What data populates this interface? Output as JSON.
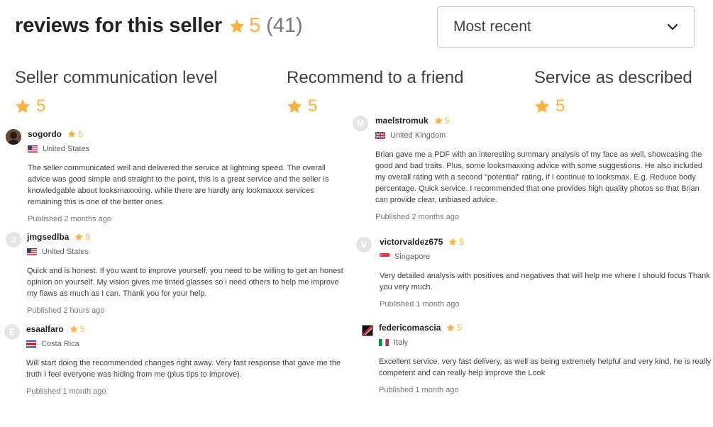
{
  "header": {
    "title": "reviews for this seller",
    "rating": "5",
    "count": "(41)",
    "star_color": "#ffb33e"
  },
  "sort": {
    "selected": "Most recent",
    "icon": "chevron-down-icon"
  },
  "categories": [
    {
      "label": "Seller communication level",
      "rating": "5"
    },
    {
      "label": "Recommend to a friend",
      "rating": "5"
    },
    {
      "label": "Service as described",
      "rating": "5"
    }
  ],
  "reviews": [
    {
      "username": "sogordo",
      "rating": "5",
      "country": "United States",
      "flag": "us-flag-icon",
      "avatar": "user-photo",
      "text": "The seller communicated well and delivered the service at lightning speed. The overall advice was good simple and straight to the point, this is a great service and the seller is knowledgable about looksmaxxxing. while there are hardly any lookmaxxx services remaining this is one of the better ones.",
      "published": "Published 2 months ago"
    },
    {
      "username": "jmgsedlba",
      "rating": "5",
      "initial": "J",
      "country": "United States",
      "flag": "us-flag-icon",
      "text": "Quick and is honest. If you want to improve yourself, you need to be willing to get an honest opinion on yourself. My vision gives me tinted glasses so i need others to help me improve my flaws as much as I can. Thank you for your help.",
      "published": "Published 2 hours ago"
    },
    {
      "username": "esaalfaro",
      "rating": "5",
      "initial": "E",
      "country": "Costa Rica",
      "flag": "cr-flag-icon",
      "text": "Will start doing the recommended changes right away. Very fast response that gave me the truth I feel everyone was hiding from me (plus tips to improve).",
      "published": "Published 1 month ago"
    },
    {
      "username": "maelstromuk",
      "rating": "5",
      "initial": "M",
      "country": "United Kingdom",
      "flag": "uk-flag-icon",
      "text": "Brian gave me a PDF with an interesting summary analysis of my face as well, showcasing the good and bad traits. Plus, some looksmaxxing advice with some suggestions. He also included my overall rating with a second \"potential\" rating, if I continue to looksmax. E.g. Reduce body percentage. Quick service. I recommended that one provides high quality photos so that Brian can provide clear, unbiased advice.",
      "published": "Published 2 months ago"
    },
    {
      "username": "victorvaldez675",
      "rating": "5",
      "initial": "V",
      "country": "Singapore",
      "flag": "sg-flag-icon",
      "text": "Very detailed analysis with positives and negatives that will help me where I should focus Thank you very much.",
      "published": "Published 1 month ago"
    },
    {
      "username": "federicomascia",
      "rating": "5",
      "country": "Italy",
      "flag": "it-flag-icon",
      "avatar": "logo",
      "text": "Excellent service, very fast delivery, as well as being extremely helpful and very kind, he is really competent and can really help improve the Look",
      "published": "Published 1 month ago"
    }
  ]
}
